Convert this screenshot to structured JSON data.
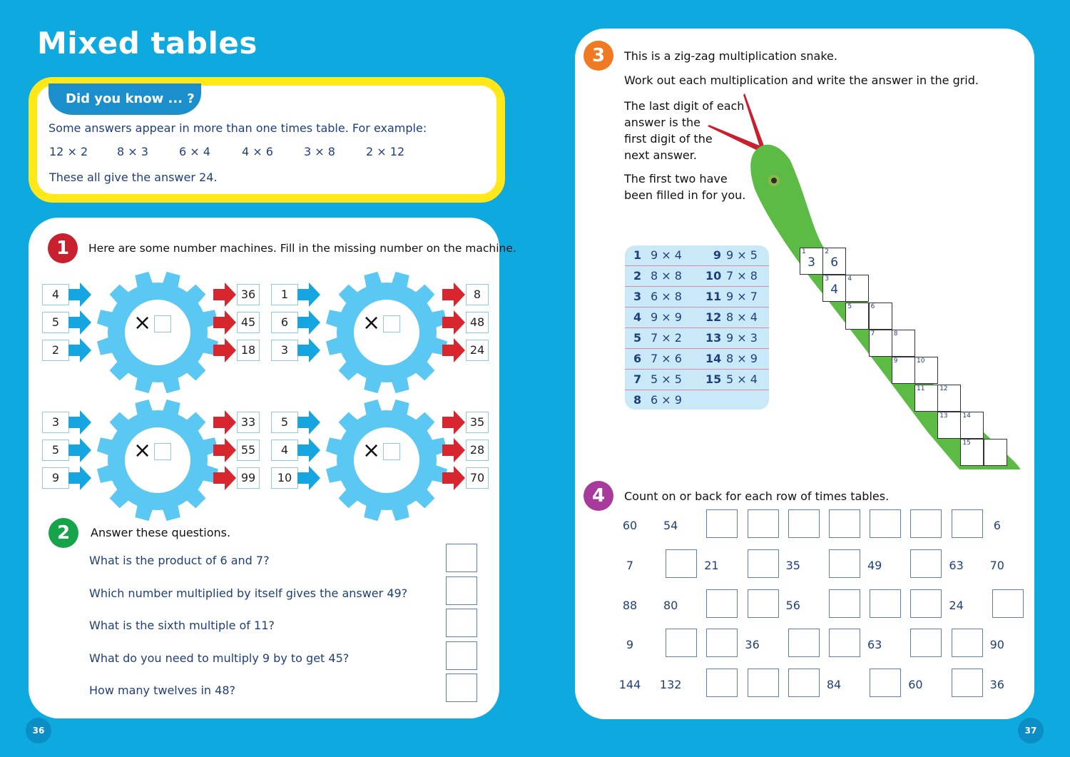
{
  "page_title": "Mixed tables",
  "did_you_know": {
    "heading": "Did you know ... ?",
    "intro": "Some answers appear in more than one times table. For example:",
    "examples": [
      "12 × 2",
      "8 × 3",
      "6 × 4",
      "4 × 6",
      "3 × 8",
      "2 × 12"
    ],
    "conclusion": "These all give the answer 24."
  },
  "q1": {
    "number": "1",
    "instruction": "Here are some number machines. Fill in the missing number on the machine.",
    "operator": "×",
    "machines": [
      {
        "inputs": [
          "4",
          "5",
          "2"
        ],
        "outputs": [
          "36",
          "45",
          "18"
        ]
      },
      {
        "inputs": [
          "1",
          "6",
          "3"
        ],
        "outputs": [
          "8",
          "48",
          "24"
        ]
      },
      {
        "inputs": [
          "3",
          "5",
          "9"
        ],
        "outputs": [
          "33",
          "55",
          "99"
        ]
      },
      {
        "inputs": [
          "5",
          "4",
          "10"
        ],
        "outputs": [
          "35",
          "28",
          "70"
        ]
      }
    ]
  },
  "q2": {
    "number": "2",
    "instruction": "Answer these questions.",
    "questions": [
      "What is the product of 6 and 7?",
      "Which number multiplied by itself gives the answer 49?",
      "What is the sixth multiple of 11?",
      "What do you need to multiply 9 by to get 45?",
      "How many twelves in 48?"
    ]
  },
  "q3": {
    "number": "3",
    "line1": "This is a zig-zag multiplication snake.",
    "line2": "Work out each multiplication and write the answer in the grid.",
    "hint": [
      "The last digit of each",
      "answer is the",
      "first digit of the",
      "next answer."
    ],
    "note": [
      "The first two have",
      "been filled in for you."
    ],
    "clues": [
      {
        "n": "1",
        "expr": "9 × 4"
      },
      {
        "n": "2",
        "expr": "8 × 8"
      },
      {
        "n": "3",
        "expr": "6 × 8"
      },
      {
        "n": "4",
        "expr": "9 × 9"
      },
      {
        "n": "5",
        "expr": "7 × 2"
      },
      {
        "n": "6",
        "expr": "7 × 6"
      },
      {
        "n": "7",
        "expr": "5 × 5"
      },
      {
        "n": "8",
        "expr": "6 × 9"
      },
      {
        "n": "9",
        "expr": "9 × 5"
      },
      {
        "n": "10",
        "expr": "7 × 8"
      },
      {
        "n": "11",
        "expr": "9 × 7"
      },
      {
        "n": "12",
        "expr": "8 × 4"
      },
      {
        "n": "13",
        "expr": "9 × 3"
      },
      {
        "n": "14",
        "expr": "8 × 9"
      },
      {
        "n": "15",
        "expr": "5 × 4"
      }
    ],
    "grid_cells": [
      {
        "label": "1",
        "value": "3"
      },
      {
        "label": "2",
        "value": "6"
      },
      {
        "label": "3",
        "value": "4"
      },
      {
        "label": "4",
        "value": ""
      },
      {
        "label": "5",
        "value": ""
      },
      {
        "label": "6",
        "value": ""
      },
      {
        "label": "7",
        "value": ""
      },
      {
        "label": "8",
        "value": ""
      },
      {
        "label": "9",
        "value": ""
      },
      {
        "label": "10",
        "value": ""
      },
      {
        "label": "11",
        "value": ""
      },
      {
        "label": "12",
        "value": ""
      },
      {
        "label": "13",
        "value": ""
      },
      {
        "label": "14",
        "value": ""
      },
      {
        "label": "15",
        "value": ""
      },
      {
        "label": "",
        "value": ""
      }
    ]
  },
  "q4": {
    "number": "4",
    "instruction": "Count on or back for each row of times tables.",
    "rows": [
      [
        "60",
        "54",
        "",
        "",
        "",
        "",
        "",
        "",
        "",
        "6"
      ],
      [
        "7",
        "",
        "21",
        "",
        "35",
        "",
        "49",
        "",
        "63",
        "70"
      ],
      [
        "88",
        "80",
        "",
        "",
        "56",
        "",
        "",
        "",
        "24",
        ""
      ],
      [
        "9",
        "",
        "",
        "36",
        "",
        "",
        "63",
        "",
        "",
        "90"
      ],
      [
        "144",
        "132",
        "",
        "",
        "",
        "84",
        "",
        "60",
        "",
        "36"
      ]
    ]
  },
  "page_numbers": {
    "left": "36",
    "right": "37"
  },
  "colors": {
    "background": "#0eaadf",
    "badge1": "#c8202e",
    "badge2": "#16a34a",
    "badge3": "#f07a22",
    "badge4": "#a73a9b",
    "gear": "#5ac8f2",
    "arrow_in": "#15a6e2",
    "arrow_out": "#d8262e",
    "snake": "#5cbb45",
    "yellow": "#ffe81a"
  }
}
